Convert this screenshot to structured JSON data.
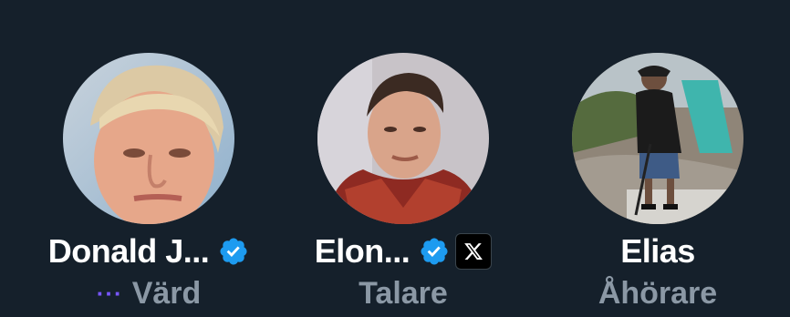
{
  "participants": [
    {
      "name": "Donald J...",
      "role": "Värd",
      "verified": true,
      "has_affiliate_badge": false,
      "role_indicator": "···",
      "avatar": "avatar-photo"
    },
    {
      "name": "Elon...",
      "role": "Talare",
      "verified": true,
      "has_affiliate_badge": true,
      "avatar": "avatar-photo"
    },
    {
      "name": "Elias",
      "role": "Åhörare",
      "verified": false,
      "has_affiliate_badge": false,
      "avatar": "avatar-photo"
    }
  ],
  "colors": {
    "background": "#15202b",
    "name": "#ffffff",
    "role": "#8b98a5",
    "verified_badge": "#1d9bf0",
    "speaking_dots": "#7856ff"
  },
  "icons": {
    "verified": "verified-badge-icon",
    "affiliate": "x-logo-icon"
  }
}
